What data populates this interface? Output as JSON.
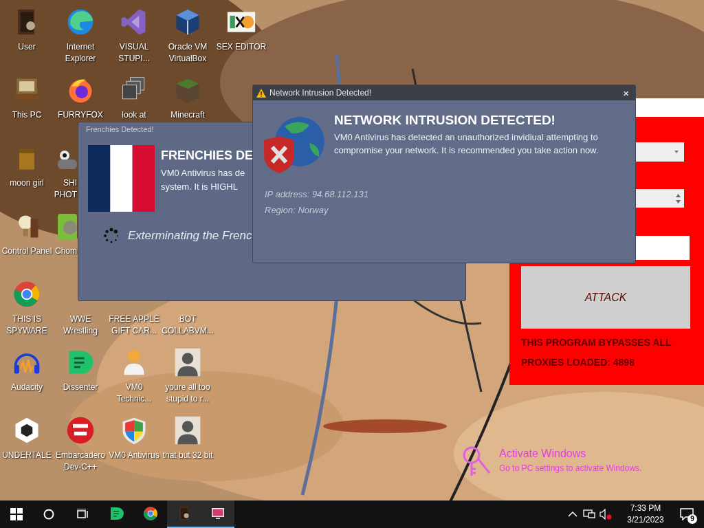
{
  "desktop": {
    "icon_rows": [
      [
        {
          "label": "User",
          "kind": "folder",
          "cut": false
        },
        {
          "label": "Internet Explorer",
          "kind": "edge",
          "cut": false
        },
        {
          "label": "VISUAL STUPI...",
          "kind": "vs",
          "cut": false
        },
        {
          "label": "Oracle VM VirtualBox",
          "kind": "cube",
          "cut": false
        },
        {
          "label": "SEX EDITOR",
          "kind": "hex",
          "cut": false
        }
      ],
      [
        {
          "label": "This PC",
          "kind": "pc",
          "cut": false
        },
        {
          "label": "FURRYFOX",
          "kind": "firefox",
          "cut": false
        },
        {
          "label": "look at",
          "kind": "windows",
          "cut": false
        },
        {
          "label": "Minecraft",
          "kind": "grass",
          "cut": false
        }
      ],
      [
        {
          "label": "moon girl",
          "kind": "box",
          "cut": false
        },
        {
          "label": "SHI PHOT",
          "kind": "eye",
          "cut": true
        }
      ],
      [
        {
          "label": "Control Panel",
          "kind": "bulb",
          "cut": false
        },
        {
          "label": "Chom",
          "kind": "animal",
          "cut": true
        }
      ],
      [
        {
          "label": "THIS IS SPYWARE",
          "kind": "chrome",
          "cut": false
        },
        {
          "label": "WWE Wrestling",
          "kind": "hidden",
          "cut": false
        },
        {
          "label": "FREE APPLE GIFT CAR...",
          "kind": "hidden",
          "cut": false
        },
        {
          "label": "BOT COLLABVM...",
          "kind": "hidden",
          "cut": false
        }
      ],
      [
        {
          "label": "Audacity",
          "kind": "headphones",
          "cut": false
        },
        {
          "label": "Dissenter",
          "kind": "dissenter",
          "cut": false
        },
        {
          "label": "VM0 Technic...",
          "kind": "doctor",
          "cut": false
        },
        {
          "label": "youre all too stupid to r...",
          "kind": "figure",
          "cut": false
        }
      ],
      [
        {
          "label": "UNDERTALE",
          "kind": "unity",
          "cut": false
        },
        {
          "label": "Embarcadero Dev-C++",
          "kind": "devcpp",
          "cut": false
        },
        {
          "label": "VM0 Antivirus",
          "kind": "shield",
          "cut": false
        },
        {
          "label": "that but 32 bit",
          "kind": "figure",
          "cut": false
        }
      ]
    ]
  },
  "bot_app": {
    "attack_button": "ATTACK",
    "notes": [
      "THIS PROGRAM BYPASSES ALL",
      "PROXIES LOADED: 4898"
    ]
  },
  "frenchies_window": {
    "title": "Frenchies Detected!",
    "heading": "FRENCHIES DE",
    "message_lines": [
      "VM0 Antivirus has de",
      "system. It is HIGHL"
    ],
    "progress_text": "Exterminating the Frenc"
  },
  "intrusion_window": {
    "title": "Network Intrusion Detected!",
    "close": "×",
    "heading": "NETWORK INTRUSION DETECTED!",
    "message": "VM0 Antivirus has detected an unauthorized invidiual attempting to compromise your network. It is recommended you take action now.",
    "details": [
      "IP address: 94.68.112.131",
      "Region: Norway"
    ]
  },
  "activation": {
    "title": "Activate Windows",
    "subtitle": "Go to PC settings to activate Windows."
  },
  "taskbar": {
    "apps": [
      {
        "kind": "dissenter",
        "selected": false
      },
      {
        "kind": "chrome",
        "selected": false
      },
      {
        "kind": "folder",
        "selected": true
      },
      {
        "kind": "monitor",
        "selected": true
      }
    ],
    "volume_muted": true,
    "time": "7:33 PM",
    "date": "3/21/2023",
    "notifications": "9"
  }
}
